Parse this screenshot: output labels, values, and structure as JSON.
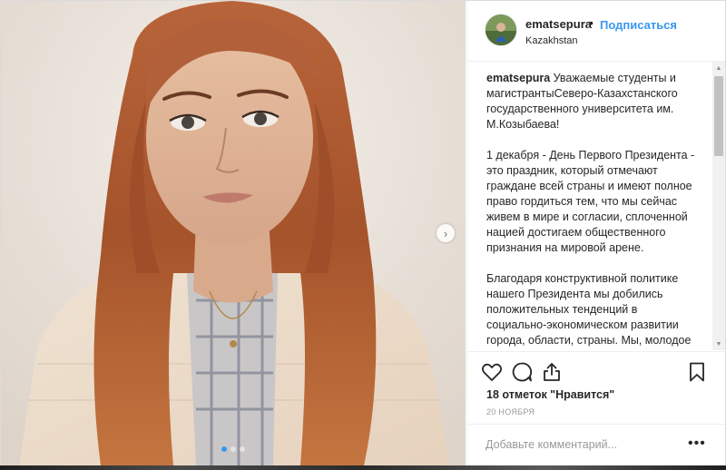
{
  "header": {
    "username": "ematsepura",
    "separator": "•",
    "follow_label": "Подписаться",
    "location": "Kazakhstan"
  },
  "caption": {
    "username": "ematsepura",
    "text": "Уважаемые студенты и магистрантыСеверо-Казахстанского государственного университета им. М.Козыбаева!\n\n1 декабря - День Первого Президента - это праздник, который отмечают граждане всей страны и имеют полное право гордиться тем, что мы сейчас живем в мире и согласии, сплоченной нацией достигаем общественного признания на мировой арене.\n\nБлагодаря конструктивной политике нашего Президента мы добились положительных тенденций в социально-экономическом развитии города, области, страны. Мы, молодое поколение, являемся гарантом развития во всех направлениях общественной"
  },
  "stats": {
    "likes": "18 отметок \"Нравится\"",
    "date": "20 НОЯБРЯ"
  },
  "comment": {
    "placeholder": "Добавьте комментарий...",
    "more": "•••"
  },
  "carousel": {
    "count": 3,
    "active_index": 0
  },
  "icons": {
    "like": "heart-icon",
    "comment": "comment-bubble-icon",
    "share": "share-icon",
    "save": "bookmark-icon",
    "next": "chevron-right-icon",
    "scroll_up": "triangle-up-icon",
    "scroll_down": "triangle-down-icon"
  },
  "colors": {
    "link": "#3897f0",
    "text": "#262626",
    "muted": "#999999"
  }
}
